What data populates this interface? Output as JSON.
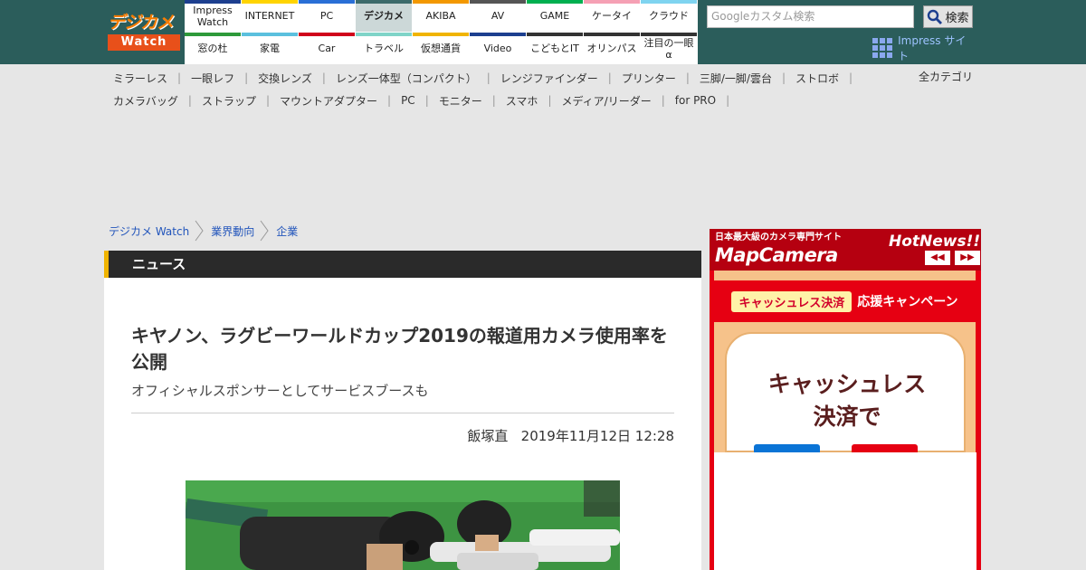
{
  "logo": {
    "top": "デジカメ",
    "bottom": "Watch"
  },
  "nav": {
    "row1": [
      {
        "label": "Impress Watch",
        "color": "#1d3f8f"
      },
      {
        "label": "INTERNET",
        "color": "#ffd400"
      },
      {
        "label": "PC",
        "color": "#2a6fd6"
      },
      {
        "label": "デジカメ",
        "color": "#3c6b6b",
        "active": true
      },
      {
        "label": "AKIBA",
        "color": "#f39800"
      },
      {
        "label": "AV",
        "color": "#555555"
      },
      {
        "label": "GAME",
        "color": "#00b050"
      },
      {
        "label": "ケータイ",
        "color": "#f5a0b4"
      },
      {
        "label": "クラウド",
        "color": "#7fd4f0"
      }
    ],
    "row2": [
      {
        "label": "窓の杜",
        "color": "#2e9a3a"
      },
      {
        "label": "家電",
        "color": "#5bc0de"
      },
      {
        "label": "Car",
        "color": "#d0021b"
      },
      {
        "label": "トラベル",
        "color": "#7fd4c8"
      },
      {
        "label": "仮想通貨",
        "color": "#f0b400"
      },
      {
        "label": "Video",
        "color": "#1d3f8f"
      },
      {
        "label": "こどもとIT",
        "color": "#333333"
      },
      {
        "label": "オリンパス",
        "color": "#333333"
      },
      {
        "label": "注目の一眼α",
        "color": "#333333"
      }
    ]
  },
  "search": {
    "placeholder": "Googleカスタム検索",
    "button_label": "検索"
  },
  "impress_link": "Impress サイト",
  "categories": {
    "row1": [
      "ミラーレス",
      "一眼レフ",
      "交換レンズ",
      "レンズ一体型（コンパクト）",
      "レンジファインダー",
      "プリンター",
      "三脚/一脚/雲台",
      "ストロボ"
    ],
    "row2": [
      "カメラバッグ",
      "ストラップ",
      "マウントアダプター",
      "PC",
      "モニター",
      "スマホ",
      "メディア/リーダー",
      "for PRO"
    ],
    "all": "全カテゴリ"
  },
  "breadcrumb": [
    "デジカメ Watch",
    "業界動向",
    "企業"
  ],
  "article": {
    "section": "ニュース",
    "title": "キヤノン、ラグビーワールドカップ2019の報道用カメラ使用率を公開",
    "subtitle": "オフィシャルスポンサーとしてサービスブースも",
    "author": "飯塚直",
    "date": "2019年11月12日 12:28"
  },
  "ad": {
    "small": "日本最大級のカメラ専門サイト",
    "brand": "MapCamera",
    "hot": "HotNews!!",
    "prev": "◀◀",
    "next": "▶▶",
    "pill": "キャッシュレス決済",
    "campaign": "応援キャンペーン",
    "card_line1": "キャッシュレス",
    "card_line2": "決済で"
  },
  "colors": {
    "topbar": "#2b5d5b",
    "accent": "#f0b400",
    "ad_red": "#e60012",
    "link": "#2255bb"
  }
}
